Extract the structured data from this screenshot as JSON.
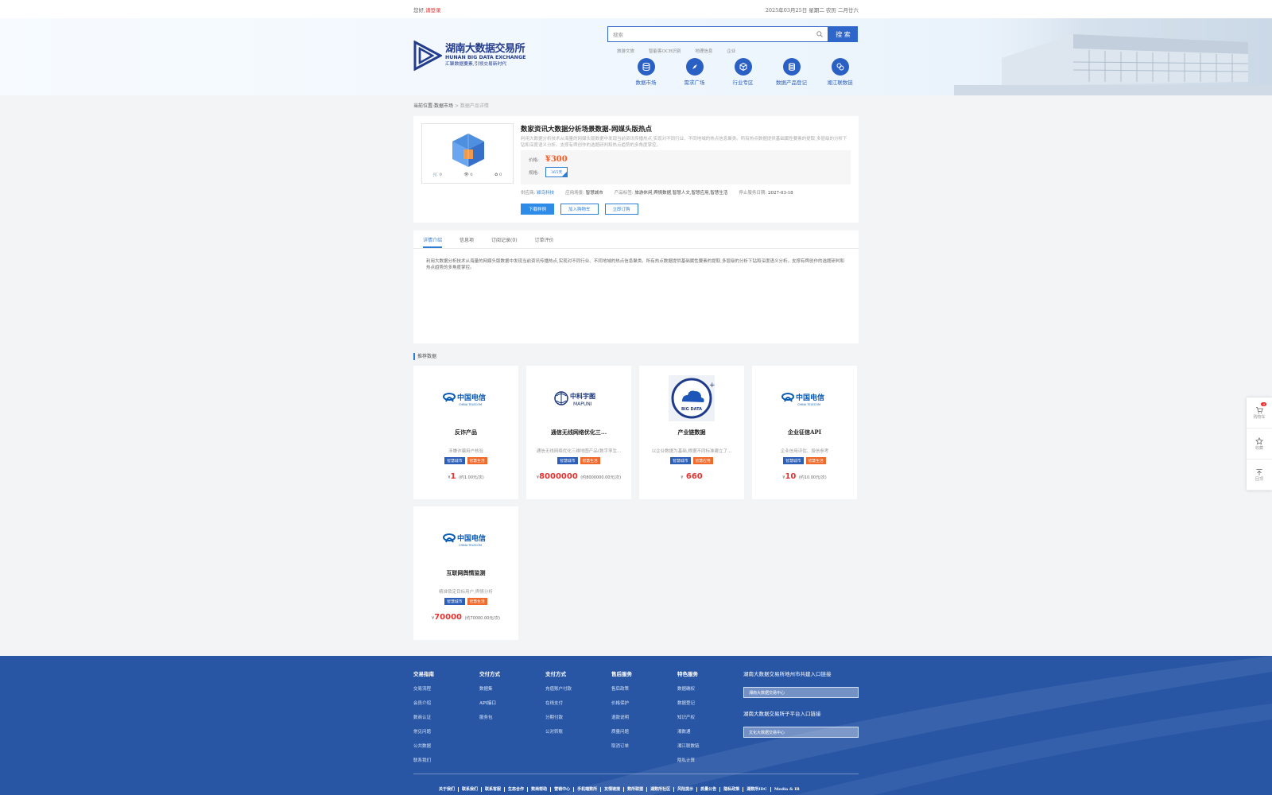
{
  "topbar": {
    "greeting": "您好,",
    "login": "请登录",
    "date": "2025年03月25日 星期二 农历 二月廿六"
  },
  "logo": {
    "cn": "湖南大数据交易所",
    "en": "HUNAN BIG DATA EXCHANGE",
    "slogan": "汇聚数据要素,引领交易新时代"
  },
  "search": {
    "placeholder": "搜索",
    "button": "搜 索"
  },
  "hot_words": [
    "旅游文旅",
    "智能客OCR识别",
    "地理信息",
    "企业"
  ],
  "nav": [
    {
      "label": "数据市场",
      "icon": "database-icon"
    },
    {
      "label": "需求广场",
      "icon": "compass-icon"
    },
    {
      "label": "行业专区",
      "icon": "cube-icon"
    },
    {
      "label": "数据产品登记",
      "icon": "coin-stack-icon"
    },
    {
      "label": "湘江联数链",
      "icon": "link-icon"
    }
  ],
  "breadcrumb": {
    "prefix": "当前位置:",
    "parent": "数据市场",
    "sep": ">",
    "current": "数据产品详情"
  },
  "product": {
    "title": "数家资讯大数据分析场景数据-网媒头版热点",
    "desc": "利用大数据分析技术从海量的网媒头版数据中发现当前资讯传播热点,实现对不同行业、不同地域的热点信息聚类。所有热点数据提供基础属性要素的提取,多层级的分析下钻和深度语义分析。支撑有舆创作的选题研判和热点趋势的多角度掌控。",
    "price_label": "价格:",
    "price": "¥300",
    "spec_label": "规格:",
    "spec": "365天",
    "supplier_label": "供应商:",
    "supplier": "颖鸟科技",
    "scene_label": "应用场景:",
    "scene": "智慧城市",
    "tag_label": "产品标签:",
    "tags": "旅游休闲,舆情数据,智慧人文,智慧应用,智慧生活",
    "expire_label": "停止服务日期:",
    "expire": "2027-03-18",
    "thumb_actions": [
      "0",
      "0",
      "0"
    ],
    "buttons": [
      "下载样例",
      "加入购物车",
      "立即订购"
    ]
  },
  "tabs": [
    "详情介绍",
    "信息项",
    "订阅记录(0)",
    "订单评价"
  ],
  "detail_text": "利用大数据分析技术从海量的网媒头版数据中发现当前资讯传播热点,实现对不同行业、不同地域的热点信息聚类。所有热点数据提供基础属性要素的提取,多层级的分析下钻和深度语义分析。支撑有舆创作的选题研判和热点趋势的多角度掌控。",
  "recommend_title": "推荐数据",
  "cards": [
    {
      "name": "反诈产品",
      "desc": "涉嫌诈骗用户核验",
      "tags": [
        "智慧城市",
        "智慧生活"
      ],
      "price": "1",
      "unit": "(约1.00元/次)",
      "logo": "china-telecom-logo"
    },
    {
      "name": "通信无线网络优化三...",
      "desc": "通信无线网络优化三维地图产品(数字孪生...",
      "tags": [
        "智慧城市",
        "智慧生活"
      ],
      "price": "8000000",
      "unit": "(约8000000.00元/次)",
      "logo": "mapuni-logo"
    },
    {
      "name": "产业链数据",
      "desc": "以企业数据为基础,根据不同标准建立了...",
      "tags": [
        "智慧城市",
        "智慧应用"
      ],
      "price": "660",
      "unit": "",
      "logo": "big-data-logo"
    },
    {
      "name": "企业征信API",
      "desc": "企业信用评估、授信参考",
      "tags": [
        "智慧城市",
        "智慧生活"
      ],
      "price": "10",
      "unit": "(约10.00元/次)",
      "logo": "china-telecom-logo"
    },
    {
      "name": "互联网舆情监测",
      "desc": "精准锁定目标用户,舆情分析",
      "tags": [
        "智慧城市",
        "智慧生活"
      ],
      "price": "70000",
      "unit": "(约70000.00元/次)",
      "logo": "china-telecom-logo"
    }
  ],
  "logo_texts": {
    "telecom_cn": "中国电信",
    "telecom_en": "CHINA TELECOM",
    "mapuni_cn": "中科宇图",
    "mapuni_en": "MAPUNI",
    "bigdata": "BIG DATA"
  },
  "currency": "¥",
  "side": [
    {
      "label": "购物车",
      "badge": "0",
      "icon": "cart-icon"
    },
    {
      "label": "收藏",
      "icon": "star-icon"
    },
    {
      "label": "回顶",
      "icon": "back-to-top-icon"
    }
  ],
  "footer": {
    "columns": [
      {
        "title": "交易指南",
        "items": [
          "交易流程",
          "会员介绍",
          "数商认证",
          "常见问题",
          "公共数据",
          "联系我们"
        ]
      },
      {
        "title": "交付方式",
        "items": [
          "数据集",
          "API接口",
          "服务包"
        ]
      },
      {
        "title": "支付方式",
        "items": [
          "充值账户付款",
          "在线支付",
          "分期付款",
          "公对转账"
        ]
      },
      {
        "title": "售后服务",
        "items": [
          "售后政策",
          "价格保护",
          "退款说明",
          "质量问题",
          "取消订单"
        ]
      },
      {
        "title": "特色服务",
        "items": [
          "数据确权",
          "数据登记",
          "知识产权",
          "湘数通",
          "湘江联数链",
          "隐私计算"
        ]
      }
    ],
    "link1_title": "湖南大数据交易所地州市共建入口链接",
    "link1_value": "湘南大数据交易中心",
    "link2_title": "湖南大数据交易所子平台入口链接",
    "link2_value": "文化大数据交易中心",
    "bottom_links": [
      "关于我们",
      "联系我们",
      "联系客服",
      "生态合作",
      "数商帮助",
      "营销中心",
      "手机端数所",
      "友情链接",
      "数所联盟",
      "湖数所社区",
      "风险提示",
      "质量公告",
      "隐私政策",
      "湖数所IDC",
      "Media & IR"
    ]
  }
}
